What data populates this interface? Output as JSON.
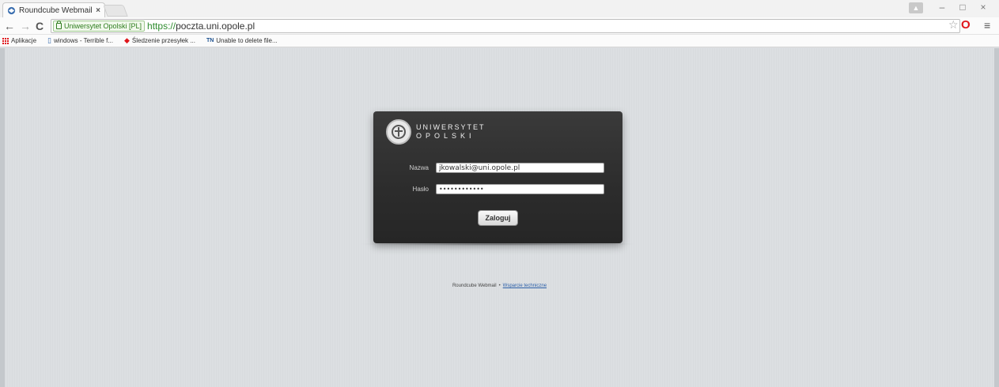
{
  "browser": {
    "tab_title": "Roundcube Webmail :: W",
    "tab_close": "×",
    "security_chip": "Uniwersytet Opolski [PL]",
    "url_protocol": "https://",
    "url_host": "poczta.uni.opole.pl",
    "bookmarks": [
      {
        "label": "Aplikacje",
        "icon": "apps-grid-icon"
      },
      {
        "label": "windows - Terrible f...",
        "icon": "page-icon"
      },
      {
        "label": "Śledzenie przesyłek ...",
        "icon": "tracking-icon"
      },
      {
        "label": "Unable to delete file...",
        "icon": "tn-icon"
      }
    ],
    "window_controls": [
      "–",
      "□",
      "×"
    ],
    "accent_opera": "#e0161b"
  },
  "login": {
    "logo_line1": "UNIWERSYTET",
    "logo_line2": "OPOLSKI",
    "username_label": "Nazwa",
    "username_value": "jkowalski@uni.opole.pl",
    "password_label": "Hasło",
    "password_value": "••••••••••••",
    "submit_label": "Zaloguj"
  },
  "footer": {
    "product": "Roundcube Webmail",
    "separator": "•",
    "support_link": "Wsparcie techniczne"
  }
}
